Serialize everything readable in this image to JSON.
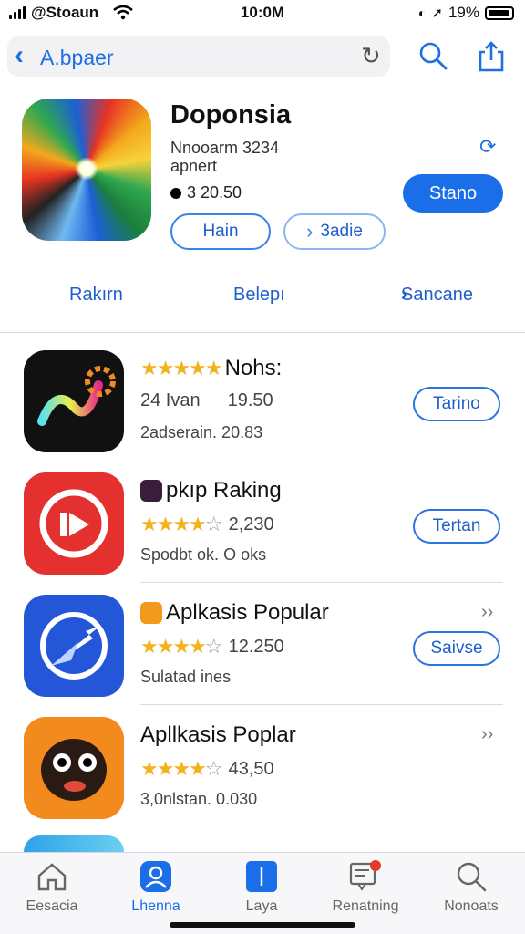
{
  "status_bar": {
    "carrier": "@Stoaun",
    "time": "10:0M",
    "battery": "19%"
  },
  "nav": {
    "back_label": "A.bpaer"
  },
  "hero": {
    "title": "Doponsia",
    "subtitle_1": "Nnooarm 3234",
    "subtitle_2": "apnert",
    "price": "3 20.50",
    "get_label": "Stano",
    "pill_1": "Hain",
    "pill_2": "3adie"
  },
  "segments": {
    "left": "Rakırn",
    "center": "Belepı",
    "right": "Sancane"
  },
  "apps": [
    {
      "name": "Nohs:",
      "meta_left": "24 Ivan",
      "meta_right": "19.50",
      "desc": "2adserain. 20.83",
      "button": "Tarino",
      "rating": 5
    },
    {
      "name": "pkıp Raking",
      "meta_right": "2,230",
      "desc": "Spodbt ok. O oks",
      "button": "Tertan",
      "rating": 4
    },
    {
      "name": "Aplkasis Popular",
      "meta_right": "12.250",
      "desc": "Sulatad ines",
      "button": "Saivse",
      "rating": 4
    },
    {
      "name": "Apllkasis Poplar",
      "meta_right": "43,50",
      "desc": "3,0nlstan. 0.030",
      "rating": 4
    }
  ],
  "tabs": [
    {
      "label": "Eesacia",
      "icon": "home-icon"
    },
    {
      "label": "Lhenna",
      "icon": "person-icon"
    },
    {
      "label": "Laya",
      "icon": "layers-icon"
    },
    {
      "label": "Renatning",
      "icon": "notification-icon"
    },
    {
      "label": "Nonoats",
      "icon": "search-icon"
    }
  ],
  "colors": {
    "accent": "#1a6fe8",
    "star": "#f3b21b",
    "background": "#ffffff"
  }
}
